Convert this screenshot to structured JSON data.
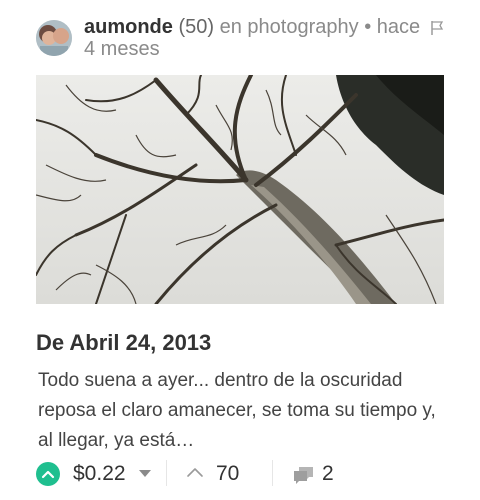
{
  "post": {
    "author": "aumonde",
    "reputation": "(50)",
    "category_prefix": "en",
    "category": "photography",
    "separator": "•",
    "time_line1": "hace",
    "time_line2": "4 meses",
    "title": "De Abril 24, 2013",
    "body": "Todo suena a ayer... dentro de la oscuridad reposa el claro amanecer, se toma su tiempo y, al llegar, ya está…"
  },
  "footer": {
    "payout": "$0.22",
    "votes": "70",
    "comments": "2"
  },
  "colors": {
    "upvote": "#1fbf8f",
    "muted": "#8a8a8a",
    "text": "#333333"
  },
  "icons": {
    "upvote": "chevron-up-icon",
    "votes": "chevron-up-icon",
    "comments": "comments-icon",
    "flag": "flag-icon",
    "payout_dropdown": "caret-down-icon"
  }
}
